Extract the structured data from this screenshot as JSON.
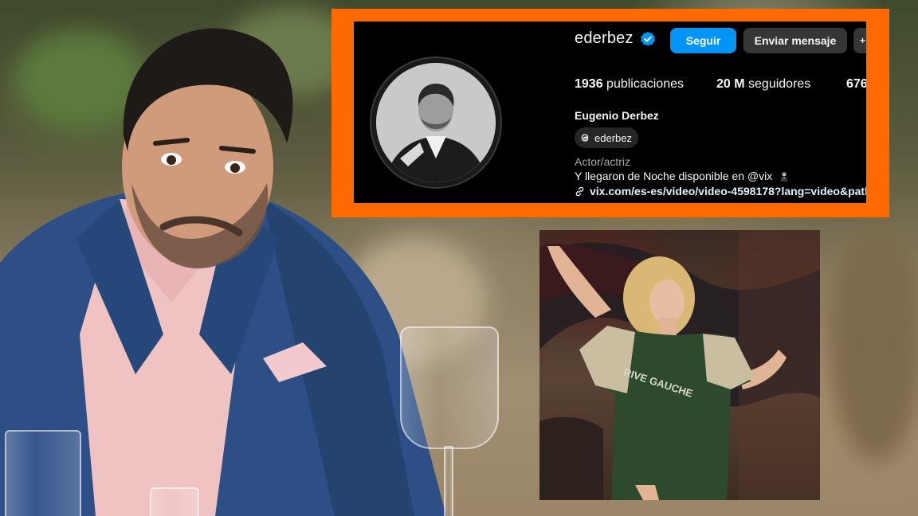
{
  "profile": {
    "username": "ederbez",
    "follow_label": "Seguir",
    "message_label": "Enviar mensaje",
    "more_label": "+",
    "stats": [
      {
        "value": "1936",
        "label": "publicaciones"
      },
      {
        "value": "20 M",
        "label": "seguidores"
      },
      {
        "value": "676",
        "label": ""
      }
    ],
    "full_name": "Eugenio Derbez",
    "threads_handle": "ederbez",
    "category": "Actor/actriz",
    "bio": "Y llegaron de Noche disponible en @vix",
    "link": "vix.com/es-es/video/video-4598178?lang=video&path"
  },
  "colors": {
    "frame": "#ff6a00",
    "follow_button": "#0095f6",
    "secondary_button": "#363636",
    "card_background": "#000000",
    "verified_badge": "#0095f6"
  },
  "icons": [
    "verified-badge-icon",
    "threads-icon",
    "link-icon",
    "person-emoji-icon"
  ]
}
